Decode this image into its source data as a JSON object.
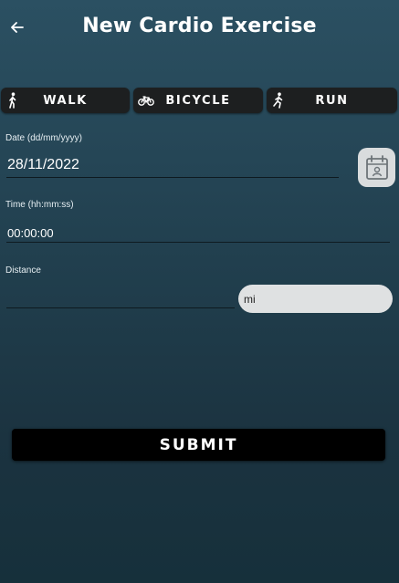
{
  "header": {
    "title": "New Cardio Exercise",
    "back_icon": "arrow-left-icon"
  },
  "exercise_types": [
    {
      "label": "WALK",
      "icon": "walking-person-icon"
    },
    {
      "label": "BICYCLE",
      "icon": "bicycle-icon"
    },
    {
      "label": "RUN",
      "icon": "running-person-icon"
    }
  ],
  "date_field": {
    "label": "Date (dd/mm/yyyy)",
    "value": "28/11/2022",
    "picker_icon": "calendar-icon"
  },
  "time_field": {
    "label": "Time (hh:mm:ss)",
    "value": "00:00:00"
  },
  "distance_field": {
    "label": "Distance",
    "value": "",
    "unit": "mi"
  },
  "submit_label": "SUBMIT"
}
